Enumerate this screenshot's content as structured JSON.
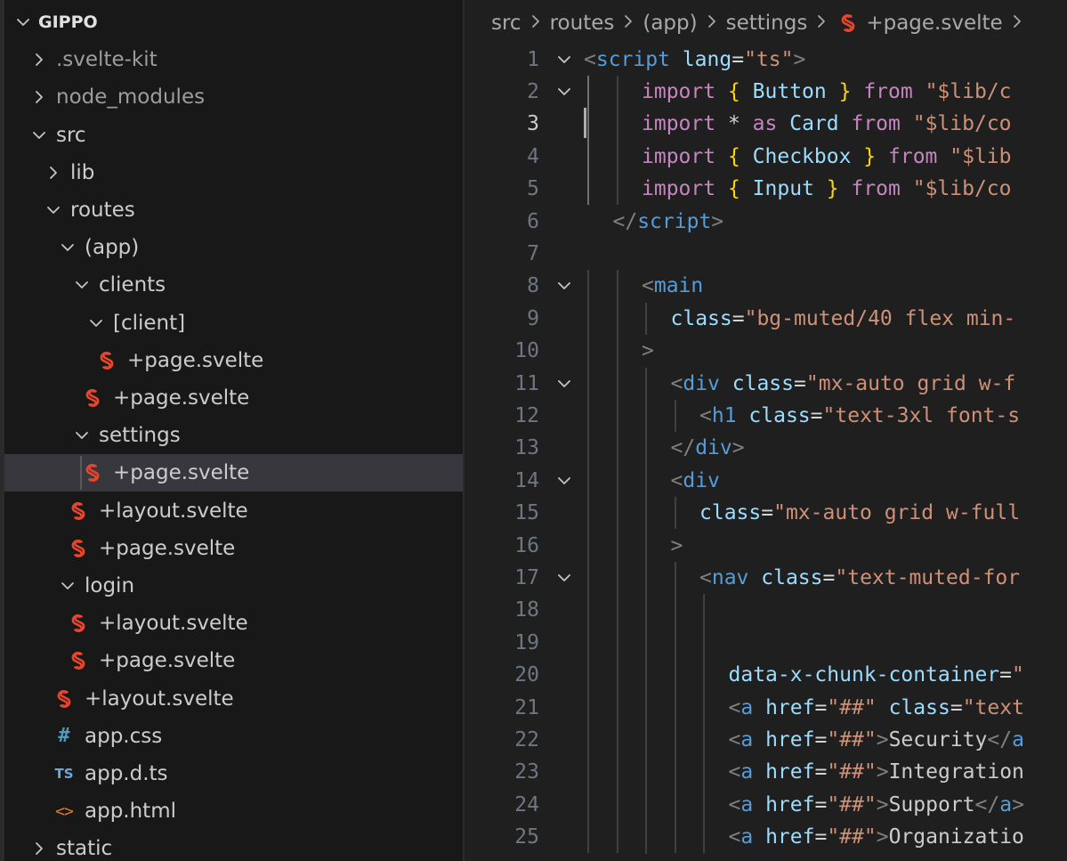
{
  "explorer": {
    "root": "GIPPO",
    "items": [
      {
        "label": ".svelte-kit",
        "kind": "folder",
        "expanded": false,
        "depth": 1,
        "dim": true
      },
      {
        "label": "node_modules",
        "kind": "folder",
        "expanded": false,
        "depth": 1,
        "dim": true
      },
      {
        "label": "src",
        "kind": "folder",
        "expanded": true,
        "depth": 1
      },
      {
        "label": "lib",
        "kind": "folder",
        "expanded": false,
        "depth": 2
      },
      {
        "label": "routes",
        "kind": "folder",
        "expanded": true,
        "depth": 2
      },
      {
        "label": "(app)",
        "kind": "folder",
        "expanded": true,
        "depth": 3
      },
      {
        "label": "clients",
        "kind": "folder",
        "expanded": true,
        "depth": 4
      },
      {
        "label": "[client]",
        "kind": "folder",
        "expanded": true,
        "depth": 5
      },
      {
        "label": "+page.svelte",
        "kind": "svelte",
        "depth": 6
      },
      {
        "label": "+page.svelte",
        "kind": "svelte",
        "depth": 5
      },
      {
        "label": "settings",
        "kind": "folder",
        "expanded": true,
        "depth": 4
      },
      {
        "label": "+page.svelte",
        "kind": "svelte",
        "depth": 5,
        "selected": true
      },
      {
        "label": "+layout.svelte",
        "kind": "svelte",
        "depth": 4
      },
      {
        "label": "+page.svelte",
        "kind": "svelte",
        "depth": 4
      },
      {
        "label": "login",
        "kind": "folder",
        "expanded": true,
        "depth": 3
      },
      {
        "label": "+layout.svelte",
        "kind": "svelte",
        "depth": 4
      },
      {
        "label": "+page.svelte",
        "kind": "svelte",
        "depth": 4
      },
      {
        "label": "+layout.svelte",
        "kind": "svelte",
        "depth": 3
      },
      {
        "label": "app.css",
        "kind": "css",
        "depth": 2
      },
      {
        "label": "app.d.ts",
        "kind": "ts",
        "depth": 2
      },
      {
        "label": "app.html",
        "kind": "html",
        "depth": 2
      },
      {
        "label": "static",
        "kind": "folder",
        "expanded": false,
        "depth": 1
      }
    ]
  },
  "breadcrumb": [
    "src",
    "routes",
    "(app)",
    "settings",
    "+page.svelte"
  ],
  "editor": {
    "current_line": 3,
    "lines": [
      {
        "n": "1",
        "fold": true,
        "indent": 0,
        "tokens": [
          [
            "<",
            "punc"
          ],
          [
            "script",
            "tag"
          ],
          [
            " ",
            ""
          ],
          [
            "lang",
            "attr"
          ],
          [
            "=",
            "op"
          ],
          [
            "\"ts\"",
            "str"
          ],
          [
            ">",
            "punc"
          ]
        ]
      },
      {
        "n": "2",
        "fold": true,
        "indent": 2,
        "tokens": [
          [
            "import",
            "kw"
          ],
          [
            " ",
            ""
          ],
          [
            "{",
            "brace"
          ],
          [
            " Button ",
            "id"
          ],
          [
            "}",
            "brace"
          ],
          [
            " ",
            ""
          ],
          [
            "from",
            "kw"
          ],
          [
            " ",
            ""
          ],
          [
            "\"$lib/c",
            "str"
          ]
        ]
      },
      {
        "n": "3",
        "fold": false,
        "indent": 2,
        "tokens": [
          [
            "import",
            "kw"
          ],
          [
            " ",
            ""
          ],
          [
            "*",
            "op"
          ],
          [
            " ",
            ""
          ],
          [
            "as",
            "kw"
          ],
          [
            " ",
            ""
          ],
          [
            "Card",
            "id"
          ],
          [
            " ",
            ""
          ],
          [
            "from",
            "kw"
          ],
          [
            " ",
            ""
          ],
          [
            "\"$lib/co",
            "str"
          ]
        ]
      },
      {
        "n": "4",
        "fold": false,
        "indent": 2,
        "tokens": [
          [
            "import",
            "kw"
          ],
          [
            " ",
            ""
          ],
          [
            "{",
            "brace"
          ],
          [
            " Checkbox ",
            "id"
          ],
          [
            "}",
            "brace"
          ],
          [
            " ",
            ""
          ],
          [
            "from",
            "kw"
          ],
          [
            " ",
            ""
          ],
          [
            "\"$lib",
            "str"
          ]
        ]
      },
      {
        "n": "5",
        "fold": false,
        "indent": 2,
        "tokens": [
          [
            "import",
            "kw"
          ],
          [
            " ",
            ""
          ],
          [
            "{",
            "brace"
          ],
          [
            " Input ",
            "id"
          ],
          [
            "}",
            "brace"
          ],
          [
            " ",
            ""
          ],
          [
            "from",
            "kw"
          ],
          [
            " ",
            ""
          ],
          [
            "\"$lib/co",
            "str"
          ]
        ]
      },
      {
        "n": "6",
        "fold": false,
        "indent": 1,
        "tokens": [
          [
            "</",
            "punc"
          ],
          [
            "script",
            "tag"
          ],
          [
            ">",
            "punc"
          ]
        ]
      },
      {
        "n": "7",
        "fold": false,
        "indent": 1,
        "tokens": []
      },
      {
        "n": "8",
        "fold": true,
        "indent": 2,
        "tokens": [
          [
            "<",
            "punc"
          ],
          [
            "main",
            "tag"
          ]
        ]
      },
      {
        "n": "9",
        "fold": false,
        "indent": 3,
        "tokens": [
          [
            "class",
            "attr"
          ],
          [
            "=",
            "op"
          ],
          [
            "\"bg-muted/40 flex min-",
            "str"
          ]
        ]
      },
      {
        "n": "10",
        "fold": false,
        "indent": 2,
        "tokens": [
          [
            ">",
            "punc"
          ]
        ]
      },
      {
        "n": "11",
        "fold": true,
        "indent": 3,
        "tokens": [
          [
            "<",
            "punc"
          ],
          [
            "div",
            "tag"
          ],
          [
            " ",
            ""
          ],
          [
            "class",
            "attr"
          ],
          [
            "=",
            "op"
          ],
          [
            "\"mx-auto grid w-f",
            "str"
          ]
        ]
      },
      {
        "n": "12",
        "fold": false,
        "indent": 4,
        "tokens": [
          [
            "<",
            "punc"
          ],
          [
            "h1",
            "tag"
          ],
          [
            " ",
            ""
          ],
          [
            "class",
            "attr"
          ],
          [
            "=",
            "op"
          ],
          [
            "\"text-3xl font-s",
            "str"
          ]
        ]
      },
      {
        "n": "13",
        "fold": false,
        "indent": 3,
        "tokens": [
          [
            "</",
            "punc"
          ],
          [
            "div",
            "tag"
          ],
          [
            ">",
            "punc"
          ]
        ]
      },
      {
        "n": "14",
        "fold": true,
        "indent": 3,
        "tokens": [
          [
            "<",
            "punc"
          ],
          [
            "div",
            "tag"
          ]
        ]
      },
      {
        "n": "15",
        "fold": false,
        "indent": 4,
        "tokens": [
          [
            "class",
            "attr"
          ],
          [
            "=",
            "op"
          ],
          [
            "\"mx-auto grid w-full",
            "str"
          ]
        ]
      },
      {
        "n": "16",
        "fold": false,
        "indent": 3,
        "tokens": [
          [
            ">",
            "punc"
          ]
        ]
      },
      {
        "n": "17",
        "fold": true,
        "indent": 4,
        "tokens": [
          [
            "<",
            "punc"
          ],
          [
            "nav",
            "tag"
          ],
          [
            " ",
            ""
          ],
          [
            "class",
            "attr"
          ],
          [
            "=",
            "op"
          ],
          [
            "\"text-muted-for",
            "str"
          ]
        ]
      },
      {
        "n": "18",
        "fold": false,
        "indent": 5,
        "tokens": []
      },
      {
        "n": "19",
        "fold": false,
        "indent": 5,
        "tokens": []
      },
      {
        "n": "20",
        "fold": false,
        "indent": 5,
        "tokens": [
          [
            "data-x-chunk-container",
            "attr"
          ],
          [
            "=",
            "op"
          ],
          [
            "\"",
            "str"
          ]
        ]
      },
      {
        "n": "21",
        "fold": false,
        "indent": 5,
        "tokens": [
          [
            "<",
            "punc"
          ],
          [
            "a",
            "tag"
          ],
          [
            " ",
            ""
          ],
          [
            "href",
            "attr"
          ],
          [
            "=",
            "op"
          ],
          [
            "\"##\"",
            "str"
          ],
          [
            " ",
            ""
          ],
          [
            "class",
            "attr"
          ],
          [
            "=",
            "op"
          ],
          [
            "\"text",
            "str"
          ]
        ]
      },
      {
        "n": "22",
        "fold": false,
        "indent": 5,
        "tokens": [
          [
            "<",
            "punc"
          ],
          [
            "a",
            "tag"
          ],
          [
            " ",
            ""
          ],
          [
            "href",
            "attr"
          ],
          [
            "=",
            "op"
          ],
          [
            "\"##\"",
            "str"
          ],
          [
            ">",
            "punc"
          ],
          [
            "Security",
            "text"
          ],
          [
            "</",
            "punc"
          ],
          [
            "a",
            "tag"
          ]
        ]
      },
      {
        "n": "23",
        "fold": false,
        "indent": 5,
        "tokens": [
          [
            "<",
            "punc"
          ],
          [
            "a",
            "tag"
          ],
          [
            " ",
            ""
          ],
          [
            "href",
            "attr"
          ],
          [
            "=",
            "op"
          ],
          [
            "\"##\"",
            "str"
          ],
          [
            ">",
            "punc"
          ],
          [
            "Integration",
            "text"
          ]
        ]
      },
      {
        "n": "24",
        "fold": false,
        "indent": 5,
        "tokens": [
          [
            "<",
            "punc"
          ],
          [
            "a",
            "tag"
          ],
          [
            " ",
            ""
          ],
          [
            "href",
            "attr"
          ],
          [
            "=",
            "op"
          ],
          [
            "\"##\"",
            "str"
          ],
          [
            ">",
            "punc"
          ],
          [
            "Support",
            "text"
          ],
          [
            "</",
            "punc"
          ],
          [
            "a",
            "tag"
          ],
          [
            ">",
            "punc"
          ]
        ]
      },
      {
        "n": "25",
        "fold": false,
        "indent": 5,
        "tokens": [
          [
            "<",
            "punc"
          ],
          [
            "a",
            "tag"
          ],
          [
            " ",
            ""
          ],
          [
            "href",
            "attr"
          ],
          [
            "=",
            "op"
          ],
          [
            "\"##\"",
            "str"
          ],
          [
            ">",
            "punc"
          ],
          [
            "Organizatio",
            "text"
          ]
        ]
      }
    ]
  },
  "colors": {
    "svelte_icon": "#e8452c",
    "chevron": "#c5c5c5"
  }
}
